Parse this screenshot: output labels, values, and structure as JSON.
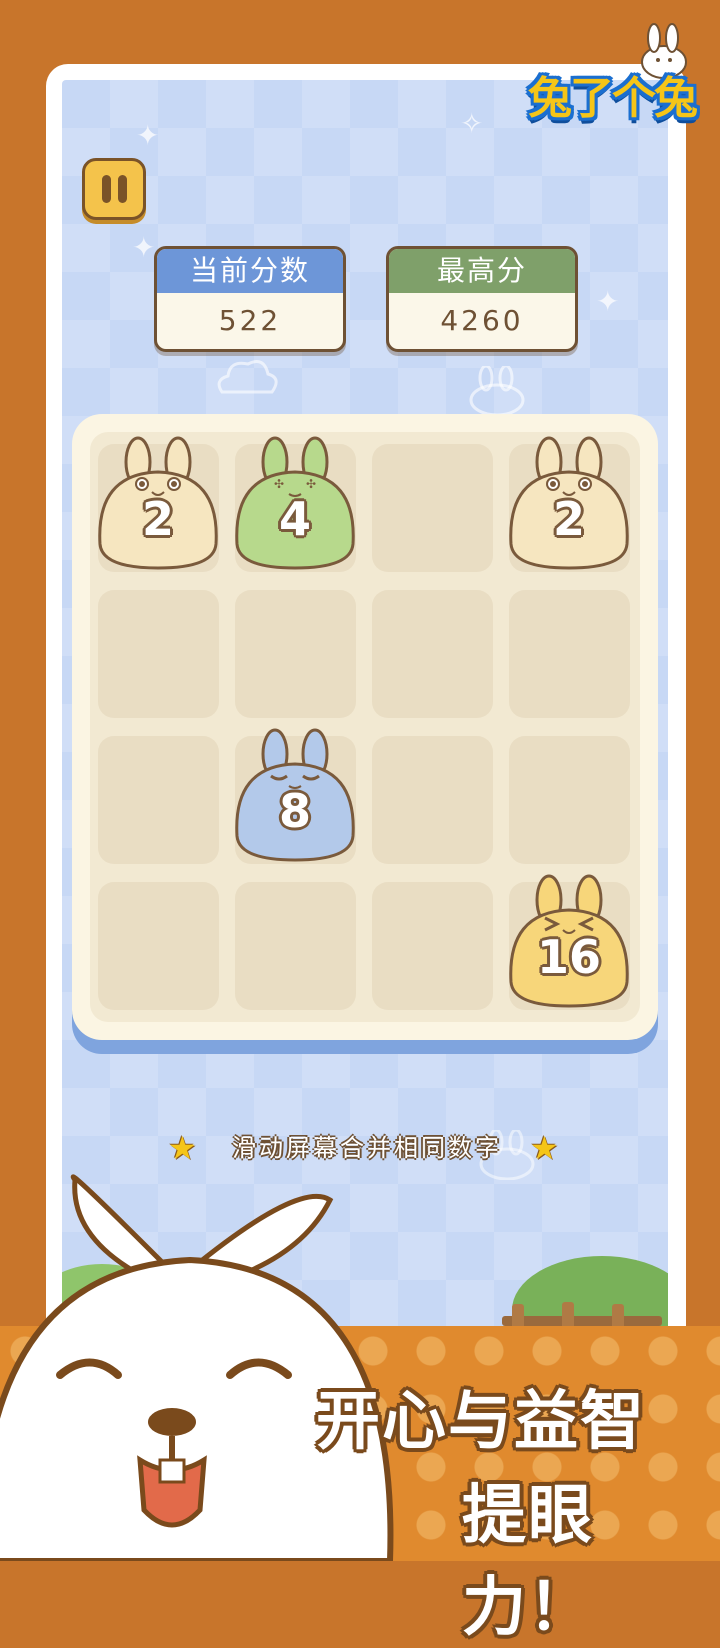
{
  "app": {
    "logo_text": "兔了个兔"
  },
  "scores": {
    "current_label": "当前分数",
    "current_value": "522",
    "best_label": "最高分",
    "best_value": "4260"
  },
  "board": {
    "rows": 4,
    "cols": 4,
    "tiles": [
      {
        "row": 0,
        "col": 0,
        "value": "2",
        "color": "#f6e6c0",
        "face": "happy"
      },
      {
        "row": 0,
        "col": 1,
        "value": "4",
        "color": "#b7d98c",
        "face": "dizzy"
      },
      {
        "row": 0,
        "col": 3,
        "value": "2",
        "color": "#f6e6c0",
        "face": "happy"
      },
      {
        "row": 2,
        "col": 1,
        "value": "8",
        "color": "#b3c9ea",
        "face": "sleepy"
      },
      {
        "row": 3,
        "col": 3,
        "value": "16",
        "color": "#f7d67a",
        "face": "laugh"
      }
    ]
  },
  "hint": {
    "text": "滑动屏幕合并相同数字"
  },
  "promo": {
    "line1": "开心与益智",
    "line2": "提眼力！"
  },
  "colors": {
    "outer_background": "#c8752b",
    "screen_background": "#c7d8f5",
    "current_label_bg": "#6d96d8",
    "best_label_bg": "#7fa06a",
    "tile_outline": "#7a5a3c"
  }
}
